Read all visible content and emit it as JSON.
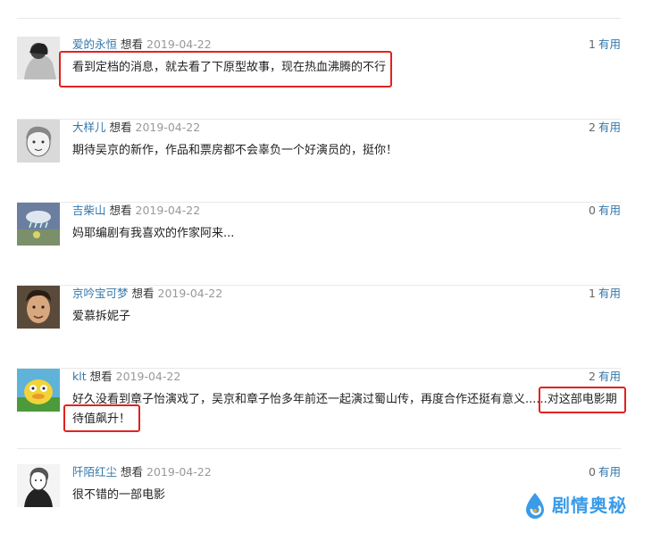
{
  "comments": [
    {
      "user": "爱的永恒",
      "status": "想看",
      "date": "2019-04-22",
      "votes": "1",
      "useful_label": "有用",
      "content": "看到定档的消息，就去看了下原型故事，现在热血沸腾的不行"
    },
    {
      "user": "大样儿",
      "status": "想看",
      "date": "2019-04-22",
      "votes": "2",
      "useful_label": "有用",
      "content": "期待吴京的新作，作品和票房都不会辜负一个好演员的，挺你！"
    },
    {
      "user": "吉柴山",
      "status": "想看",
      "date": "2019-04-22",
      "votes": "0",
      "useful_label": "有用",
      "content": "妈耶编剧有我喜欢的作家阿来..."
    },
    {
      "user": "京吟宝可梦",
      "status": "想看",
      "date": "2019-04-22",
      "votes": "1",
      "useful_label": "有用",
      "content": "爱慕拆妮子"
    },
    {
      "user": "klt",
      "status": "想看",
      "date": "2019-04-22",
      "votes": "2",
      "useful_label": "有用",
      "content": "好久没看到章子怡演戏了，吴京和章子怡多年前还一起演过蜀山传，再度合作还挺有意义......对这部电影期待值飙升！"
    },
    {
      "user": "阡陌红尘",
      "status": "想看",
      "date": "2019-04-22",
      "votes": "0",
      "useful_label": "有用",
      "content": "很不错的一部电影"
    }
  ],
  "watermark": {
    "text": "剧情奥秘",
    "color": "#3a9be8"
  },
  "highlight_color": "#e0231f"
}
